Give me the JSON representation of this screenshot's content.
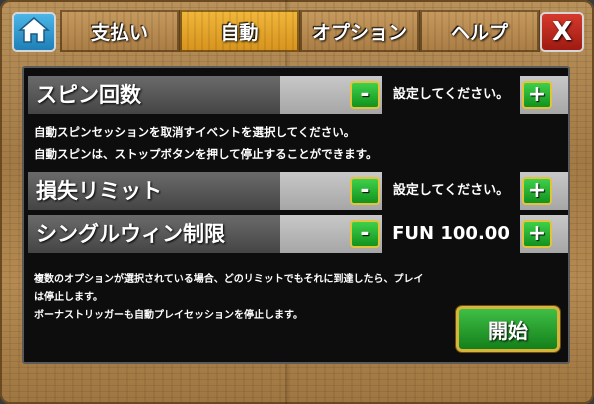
{
  "tabs": [
    {
      "label": "支払い",
      "active": false
    },
    {
      "label": "自動",
      "active": true
    },
    {
      "label": "オプション",
      "active": false
    },
    {
      "label": "ヘルプ",
      "active": false
    }
  ],
  "close_label": "X",
  "rows": {
    "spins": {
      "label": "スピン回数",
      "value": "設定してください。"
    },
    "loss_limit": {
      "label": "損失リミット",
      "value": "設定してください。"
    },
    "single_win_limit": {
      "label": "シングルウィン制限",
      "value": "FUN 100.00"
    }
  },
  "buttons": {
    "minus": "-",
    "plus": "+"
  },
  "info": {
    "line1": "自動スピンセッションを取消すイベントを選択してください。",
    "line2": "自動スピンは、ストップボタンを押して停止することができます。"
  },
  "notes": {
    "line1": "複数のオプションが選択されている場合、どのリミットでもそれに到達したら、プレイ",
    "line2": "は停止します。",
    "line3": "ボーナストリッガーも自動プレイセッションを停止します。"
  },
  "start_label": "開始",
  "colors": {
    "active_tab": "#e0a028",
    "accent_green": "#1aa326",
    "close_red": "#c02a1e",
    "home_blue": "#2a96d0"
  }
}
